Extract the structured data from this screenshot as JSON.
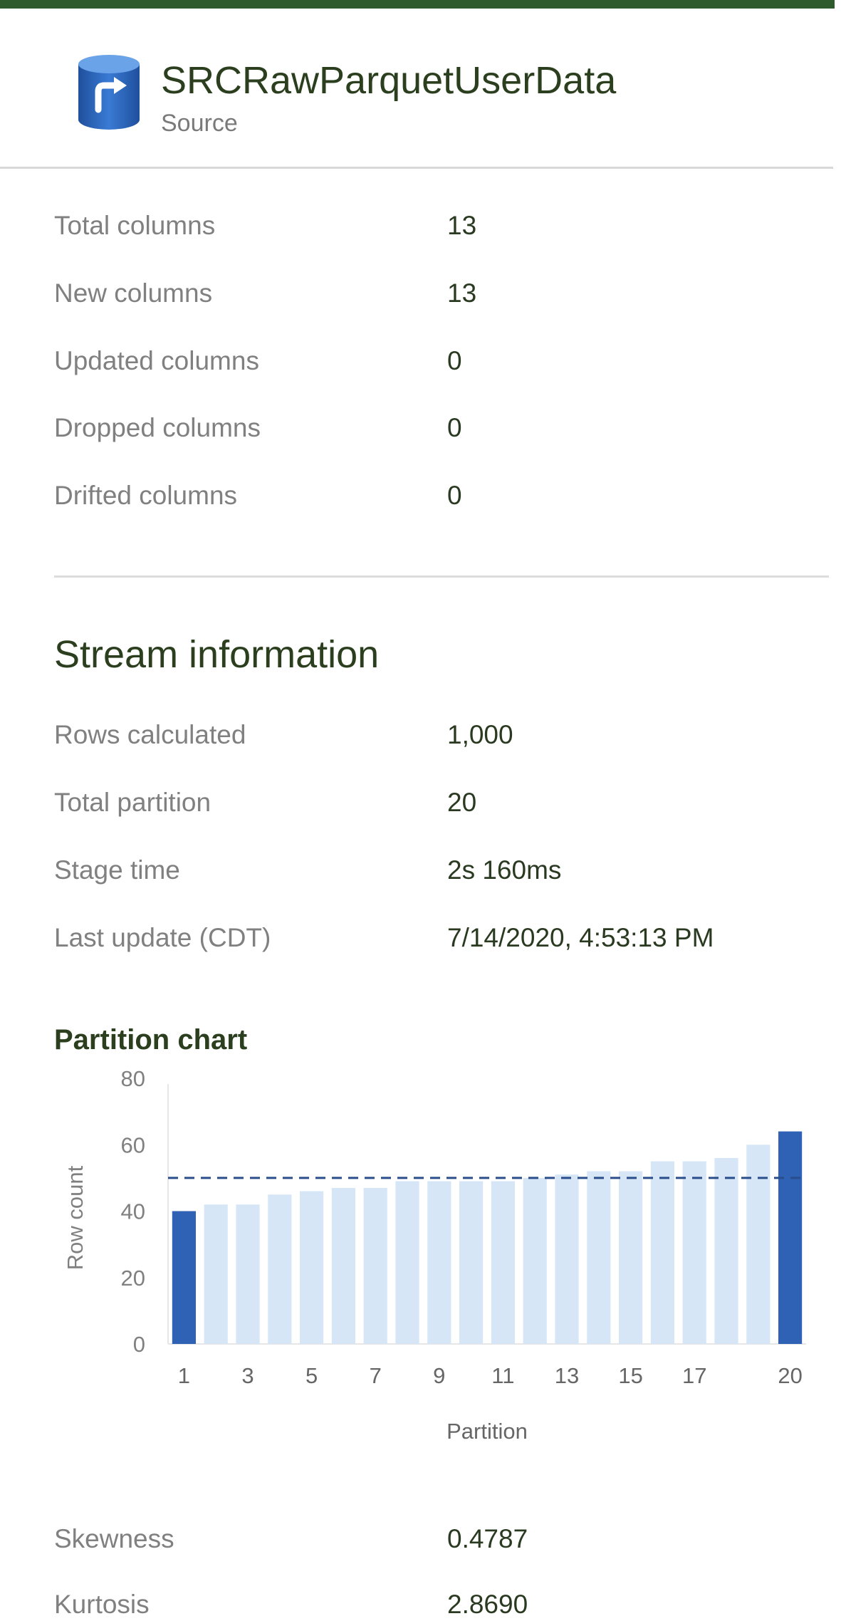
{
  "header": {
    "title": "SRCRawParquetUserData",
    "subtitle": "Source",
    "icon": "database-arrow-icon"
  },
  "column_stats": [
    {
      "label": "Total columns",
      "value": "13"
    },
    {
      "label": "New columns",
      "value": "13"
    },
    {
      "label": "Updated columns",
      "value": "0"
    },
    {
      "label": "Dropped columns",
      "value": "0"
    },
    {
      "label": "Drifted columns",
      "value": "0"
    }
  ],
  "stream": {
    "title": "Stream information",
    "items": [
      {
        "label": "Rows calculated",
        "value": "1,000"
      },
      {
        "label": "Total partition",
        "value": "20"
      },
      {
        "label": "Stage time",
        "value": "2s 160ms"
      },
      {
        "label": "Last update (CDT)",
        "value": "7/14/2020, 4:53:13 PM"
      }
    ]
  },
  "partition_chart": {
    "title": "Partition chart"
  },
  "chart_data": {
    "type": "bar",
    "xlabel": "Partition",
    "ylabel": "Row count",
    "ylim": [
      0,
      80
    ],
    "yticks": [
      "0",
      "20",
      "40",
      "60",
      "80"
    ],
    "xtick_labels": [
      "1",
      "3",
      "5",
      "7",
      "9",
      "11",
      "13",
      "15",
      "17",
      "20"
    ],
    "categories": [
      "1",
      "2",
      "3",
      "4",
      "5",
      "6",
      "7",
      "8",
      "9",
      "10",
      "11",
      "12",
      "13",
      "14",
      "15",
      "16",
      "17",
      "18",
      "19",
      "20"
    ],
    "values": [
      40,
      42,
      42,
      45,
      46,
      47,
      47,
      49,
      49,
      49,
      49,
      50,
      51,
      52,
      52,
      55,
      55,
      56,
      60,
      64
    ],
    "highlighted": [
      "1",
      "20"
    ],
    "average_line": 50,
    "colors": {
      "bar": "#d6e6f7",
      "highlight": "#2f62b4",
      "avg_line": "#2a4d8c"
    }
  },
  "stats": [
    {
      "label": "Skewness",
      "value": "0.4787"
    },
    {
      "label": "Kurtosis",
      "value": "2.8690"
    }
  ]
}
